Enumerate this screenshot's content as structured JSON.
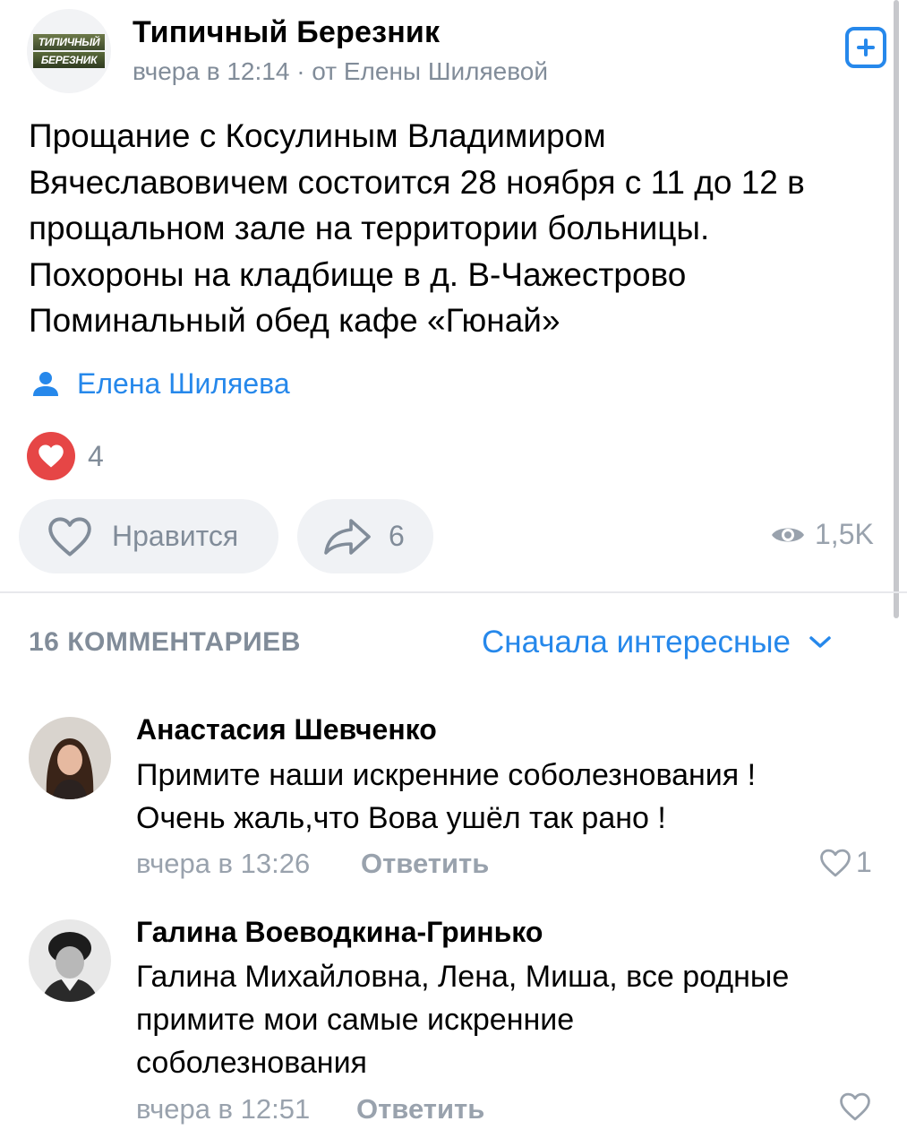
{
  "post": {
    "group_name": "Типичный Березник",
    "logo_text": [
      "ТИПИЧНЫЙ",
      "БЕРЕЗНИК"
    ],
    "meta": "вчера в 12:14 · от Елены Шиляевой",
    "text_lines": [
      "Прощание с Косулиным Владимиром",
      "Вячеславовичем состоится 28 ноября с 11 до 12 в",
      "прощальном зале на территории больницы.",
      "Похороны на кладбище в д. В-Чажестрово",
      "Поминальный обед кафе «Гюнай»"
    ],
    "author": "Елена Шиляева",
    "reactions_count": "4",
    "like_label": "Нравится",
    "share_count": "6",
    "views": "1,5K"
  },
  "comments_section": {
    "count_label": "16 КОММЕНТАРИЕВ",
    "sort_label": "Сначала интересные",
    "reply_label": "Ответить",
    "items": [
      {
        "author": "Анастасия Шевченко",
        "text_lines": [
          "Примите наши искренние соболезнования !",
          "Очень жаль,что Вова ушёл так рано !"
        ],
        "time": "вчера в 13:26",
        "likes": "1"
      },
      {
        "author": "Галина Воеводкина-Гринько",
        "text_lines": [
          "Галина Михайловна, Лена, Миша, все родные",
          "примите мои самые искренние",
          "соболезнования"
        ],
        "time": "вчера в 12:51",
        "likes": ""
      }
    ]
  },
  "icons": {
    "add": "plus-square-icon",
    "author": "person-icon",
    "reaction": "heart-filled-icon",
    "like": "heart-outline-icon",
    "share": "share-arrow-icon",
    "views": "eye-icon",
    "sort": "chevron-down-icon"
  },
  "colors": {
    "accent": "#2688eb",
    "secondary_text": "#818c99",
    "reaction_red": "#e64646",
    "pill_bg": "#f0f2f5"
  }
}
